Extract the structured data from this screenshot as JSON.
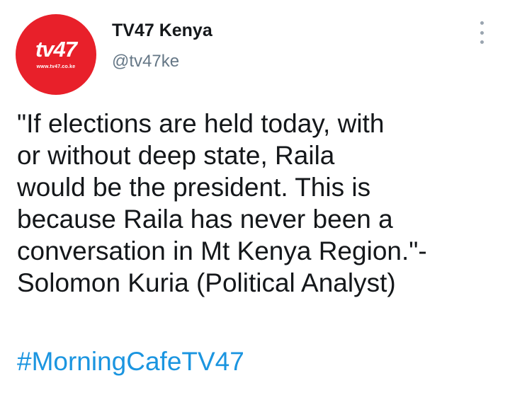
{
  "account": {
    "display_name": "TV47 Kenya",
    "handle": "@tv47ke",
    "avatar": {
      "wordmark": "tv47",
      "url_text": "www.tv47.co.ke",
      "background_color": "#e8202a"
    }
  },
  "menu": {
    "icon": "more-vertical-icon"
  },
  "tweet": {
    "text": "\"If elections are held today, with\nor without deep state, Raila\nwould be the president. This is\nbecause Raila has never been a\nconversation in Mt Kenya Region.\"-\nSolomon Kuria (Political Analyst)",
    "hashtag": "#MorningCafeTV47",
    "hashtag_color": "#1b95e0"
  }
}
